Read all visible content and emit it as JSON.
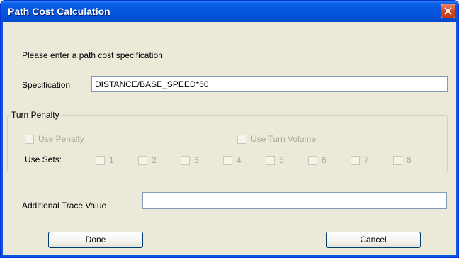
{
  "window": {
    "title": "Path Cost Calculation"
  },
  "prompt": "Please enter a path cost specification",
  "specification": {
    "label": "Specification",
    "value": "DISTANCE/BASE_SPEED*60"
  },
  "turn_penalty": {
    "legend": "Turn Penalty",
    "use_penalty": {
      "label": "Use Penalty",
      "checked": false
    },
    "use_turn_volume": {
      "label": "Use Turn Volume",
      "checked": false
    },
    "use_sets_label": "Use Sets:",
    "sets": [
      "1",
      "2",
      "3",
      "4",
      "5",
      "6",
      "7",
      "8"
    ]
  },
  "additional_trace": {
    "label": "Additional Trace Value",
    "value": ""
  },
  "buttons": {
    "done": "Done",
    "cancel": "Cancel"
  },
  "colors": {
    "titlebar": "#0655dd",
    "client_bg": "#ece9d8",
    "close_button": "#d9491e",
    "disabled_text": "#aca899"
  },
  "icons": {
    "close": "close-x-icon"
  }
}
